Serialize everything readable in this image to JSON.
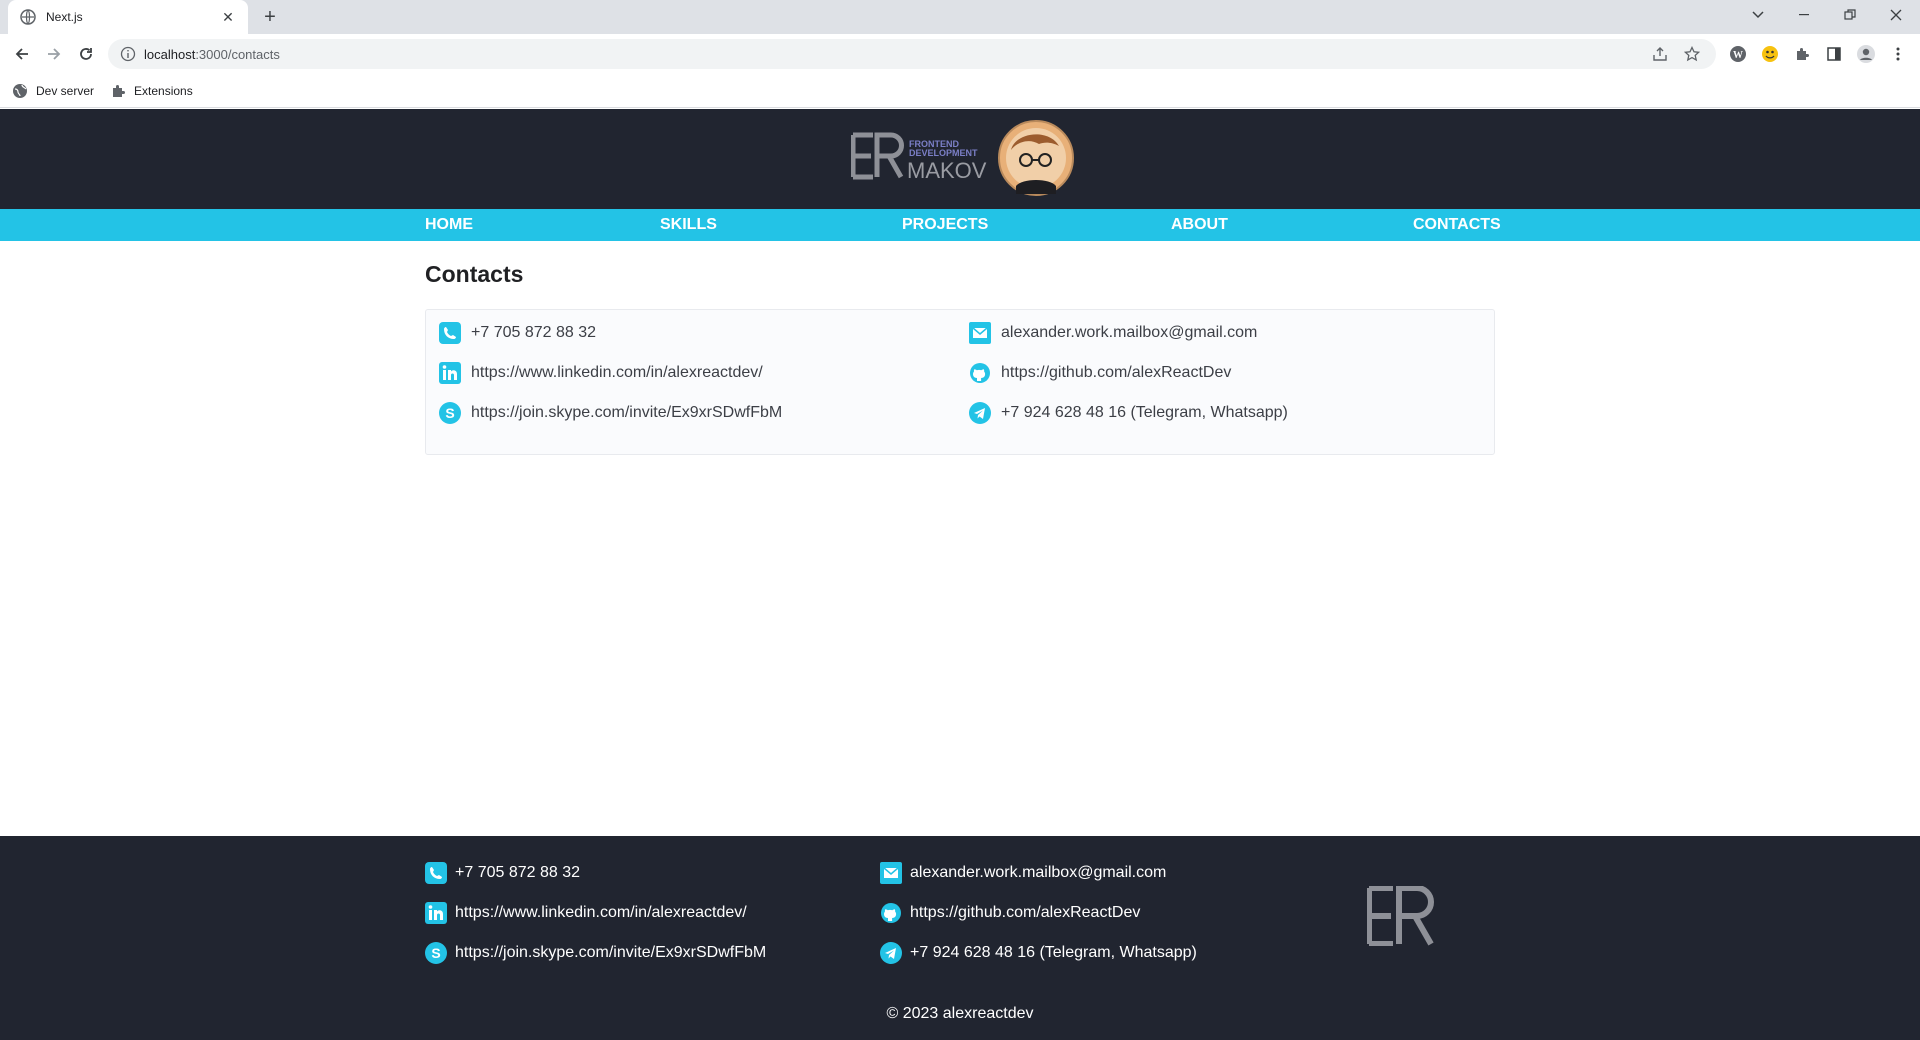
{
  "browser": {
    "tab_title": "Next.js",
    "new_tab_label": "+",
    "url_host": "localhost",
    "url_path": ":3000/contacts",
    "bookmarks": [
      {
        "label": "Dev server",
        "icon": "globe-icon"
      },
      {
        "label": "Extensions",
        "icon": "puzzle-icon"
      }
    ]
  },
  "header": {
    "logo_letters": "ER",
    "logo_line1": "FRONTEND",
    "logo_line2": "DEVELOPMENT",
    "logo_name": "MAKOV"
  },
  "nav": {
    "items": [
      {
        "label": "HOME"
      },
      {
        "label": "SKILLS"
      },
      {
        "label": "PROJECTS"
      },
      {
        "label": "ABOUT"
      },
      {
        "label": "CONTACTS"
      }
    ]
  },
  "main": {
    "title": "Contacts",
    "contacts": [
      {
        "icon": "phone-icon",
        "text": "+7 705 872 88 32"
      },
      {
        "icon": "linkedin-icon",
        "text": "https://www.linkedin.com/in/alexreactdev/"
      },
      {
        "icon": "skype-icon",
        "text": "https://join.skype.com/invite/Ex9xrSDwfFbM"
      },
      {
        "icon": "mail-icon",
        "text": "alexander.work.mailbox@gmail.com"
      },
      {
        "icon": "github-icon",
        "text": "https://github.com/alexReactDev"
      },
      {
        "icon": "telegram-icon",
        "text": "+7 924 628 48 16 (Telegram, Whatsapp)"
      }
    ]
  },
  "footer": {
    "contacts": [
      {
        "icon": "phone-icon",
        "text": "+7 705 872 88 32"
      },
      {
        "icon": "linkedin-icon",
        "text": "https://www.linkedin.com/in/alexreactdev/"
      },
      {
        "icon": "skype-icon",
        "text": "https://join.skype.com/invite/Ex9xrSDwfFbM"
      },
      {
        "icon": "mail-icon",
        "text": "alexander.work.mailbox@gmail.com"
      },
      {
        "icon": "github-icon",
        "text": "https://github.com/alexReactDev"
      },
      {
        "icon": "telegram-icon",
        "text": "+7 924 628 48 16 (Telegram, Whatsapp)"
      }
    ],
    "logo_letters": "ER",
    "copyright": "© 2023 alexreactdev"
  },
  "colors": {
    "accent": "#23c3e6",
    "dark": "#212530"
  }
}
